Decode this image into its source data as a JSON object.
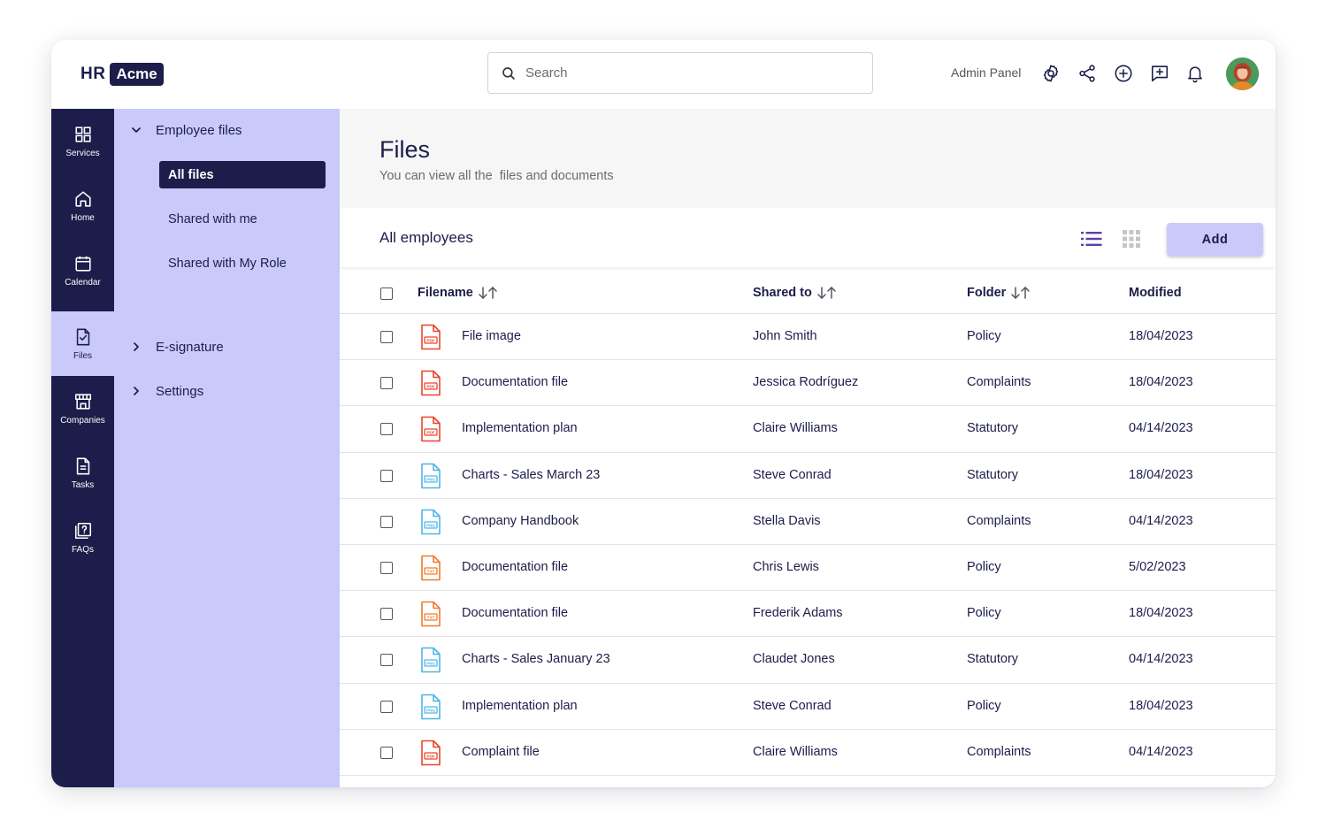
{
  "app": {
    "logo_hr": "HR",
    "logo_brand": "Acme"
  },
  "header": {
    "search_placeholder": "Search",
    "admin_panel": "Admin Panel",
    "icons": [
      "settings-icon",
      "share-icon",
      "add-circle-icon",
      "feedback-icon",
      "bell-icon"
    ]
  },
  "rail": {
    "items": [
      {
        "label": "Services",
        "icon": "grid-icon"
      },
      {
        "label": "Home",
        "icon": "home-icon"
      },
      {
        "label": "Calendar",
        "icon": "calendar-icon"
      },
      {
        "label": "Files",
        "icon": "file-check-icon",
        "active": true
      },
      {
        "label": "Companies",
        "icon": "store-icon"
      },
      {
        "label": "Tasks",
        "icon": "document-icon"
      },
      {
        "label": "FAQs",
        "icon": "help-icon"
      }
    ]
  },
  "subnav": {
    "employee_files": "Employee files",
    "all_files": "All files",
    "shared_with_me": "Shared with me",
    "shared_with_role": "Shared with My Role",
    "esignature": "E-signature",
    "settings": "Settings"
  },
  "page": {
    "title": "Files",
    "subtitle": "You can view all the  files and documents"
  },
  "toolbar": {
    "title": "All employees",
    "add_label": "Add"
  },
  "table": {
    "columns": {
      "filename": "Filename",
      "shared_to": "Shared to",
      "folder": "Folder",
      "modified": "Modified"
    },
    "rows": [
      {
        "type": "pdf",
        "filename": "File image",
        "shared_to": "John Smith",
        "folder": "Policy",
        "modified": "18/04/2023"
      },
      {
        "type": "pdf",
        "filename": "Documentation file",
        "shared_to": "Jessica Rodríguez",
        "folder": "Complaints",
        "modified": "18/04/2023"
      },
      {
        "type": "pdf",
        "filename": "Implementation plan",
        "shared_to": "Claire Williams",
        "folder": "Statutory",
        "modified": "04/14/2023"
      },
      {
        "type": "png",
        "filename": "Charts - Sales March 23",
        "shared_to": "Steve Conrad",
        "folder": "Statutory",
        "modified": "18/04/2023"
      },
      {
        "type": "png",
        "filename": "Company Handbook",
        "shared_to": "Stella Davis",
        "folder": "Complaints",
        "modified": "04/14/2023"
      },
      {
        "type": "txt",
        "filename": "Documentation file",
        "shared_to": "Chris Lewis",
        "folder": "Policy",
        "modified": "5/02/2023"
      },
      {
        "type": "txt",
        "filename": "Documentation file",
        "shared_to": "Frederik Adams",
        "folder": "Policy",
        "modified": "18/04/2023"
      },
      {
        "type": "png",
        "filename": "Charts - Sales January 23",
        "shared_to": "Claudet Jones",
        "folder": "Statutory",
        "modified": "04/14/2023"
      },
      {
        "type": "png",
        "filename": "Implementation plan",
        "shared_to": "Steve Conrad",
        "folder": "Policy",
        "modified": "18/04/2023"
      },
      {
        "type": "pdf",
        "filename": "Complaint file",
        "shared_to": "Claire Williams",
        "folder": "Complaints",
        "modified": "04/14/2023"
      }
    ]
  },
  "colors": {
    "navy": "#1c1d4a",
    "lavender": "#c9cafa",
    "pdf": "#e8452c",
    "png": "#4fb6e6",
    "txt": "#f07a2c"
  }
}
